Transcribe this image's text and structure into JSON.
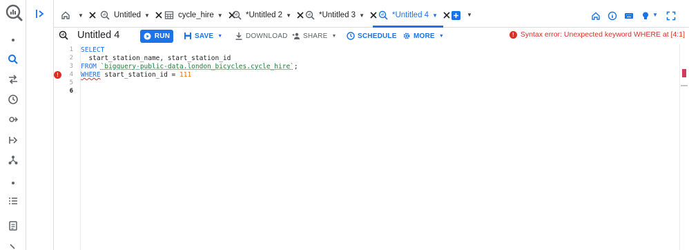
{
  "tabs": [
    {
      "label": "Untitled",
      "icon": "query-icon",
      "active": false
    },
    {
      "label": "cycle_hire",
      "icon": "table-icon",
      "active": false
    },
    {
      "label": "*Untitled 2",
      "icon": "query-icon",
      "active": false
    },
    {
      "label": "*Untitled 3",
      "icon": "query-icon",
      "active": false
    },
    {
      "label": "*Untitled 4",
      "icon": "query-icon",
      "active": true
    }
  ],
  "toolbar": {
    "query_title": "Untitled 4",
    "run_label": "RUN",
    "save_label": "SAVE",
    "download_label": "DOWNLOAD",
    "share_label": "SHARE",
    "schedule_label": "SCHEDULE",
    "more_label": "MORE",
    "error_message": "Syntax error: Unexpected keyword WHERE at [4:1]"
  },
  "editor": {
    "line_numbers": [
      "1",
      "2",
      "3",
      "4",
      "5",
      "6"
    ],
    "lines": {
      "l1_kw": "SELECT",
      "l2_text": "  start_station_name, start_station_id",
      "l3_kw": "FROM",
      "l3_str": "`bigquery-public-data.london_bicycles.cycle_hire`",
      "l3_end": ";",
      "l4_kw": "WHERE",
      "l4_text": " start_station_id = ",
      "l4_num": "111"
    },
    "error_line": 4
  },
  "colors": {
    "accent": "#1a73e8",
    "error": "#d93025",
    "string": "#188038",
    "number": "#e8710a"
  }
}
